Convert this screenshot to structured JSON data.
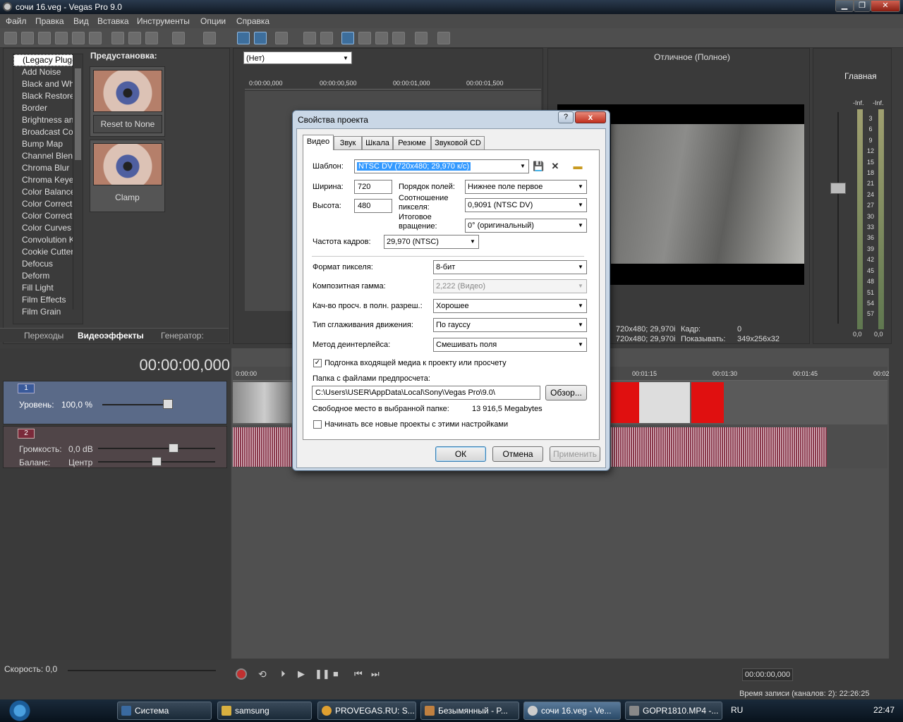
{
  "window": {
    "title": "сочи 16.veg - Vegas Pro 9.0"
  },
  "menu": [
    "Файл",
    "Правка",
    "Вид",
    "Вставка",
    "Инструменты",
    "Опции",
    "Справка"
  ],
  "effects": {
    "items": [
      "(Legacy Plug-I",
      "Add Noise",
      "Black and Whit",
      "Black Restore",
      "Border",
      "Brightness and",
      "Broadcast Colo",
      "Bump Map",
      "Channel Blend",
      "Chroma Blur",
      "Chroma Keyer",
      "Color Balance",
      "Color Correcto",
      "Color Correcto",
      "Color Curves",
      "Convolution Ke",
      "Cookie Cutter",
      "Defocus",
      "Deform",
      "Fill Light",
      "Film Effects",
      "Film Grain"
    ],
    "preset_header": "Предустановка:",
    "preset1_label": "Reset to None",
    "preset2_label": "Clamp",
    "tabs": [
      "Переходы",
      "Видеоэффекты",
      "Генератор:"
    ]
  },
  "trimmer": {
    "dropdown": "(Нет)",
    "times": [
      "0:00:00,000",
      "00:00:00,500",
      "00:00:01,000",
      "00:00:01,500"
    ]
  },
  "preview": {
    "quality": "Отличное (Полное)",
    "info1": "720x480; 29,970i",
    "info2": "720x480; 29,970i",
    "frame_label": "Кадр:",
    "frame_value": "0",
    "show_label": "Показывать:",
    "show_value": "349x256x32"
  },
  "mixer": {
    "title": "Главная",
    "inf_left": "-Inf.",
    "inf_right": "-Inf.",
    "scale": [
      "3",
      "6",
      "9",
      "12",
      "15",
      "18",
      "21",
      "24",
      "27",
      "30",
      "33",
      "36",
      "39",
      "42",
      "45",
      "48",
      "51",
      "54",
      "57"
    ],
    "bottom_left": "0,0",
    "bottom_right": "0,0"
  },
  "timeline": {
    "timecode": "00:00:00,000",
    "track1_num": "1",
    "level_label": "Уровень:",
    "level_value": "100,0 %",
    "track2_num": "2",
    "volume_label": "Громкость:",
    "volume_value": "0,0 dB",
    "pan_label": "Баланс:",
    "pan_value": "Центр",
    "ruler": [
      "0:00:00",
      "00:01:15",
      "00:01:30",
      "00:01:45",
      "00:02"
    ]
  },
  "transport": {
    "speed": "Скорость: 0,0",
    "time_display": "00:00:00,000",
    "record_time": "Время записи (каналов: 2): 22:26:25"
  },
  "dialog": {
    "title": "Свойства проекта",
    "help": "?",
    "close": "x",
    "tabs": [
      "Видео",
      "Звук",
      "Шкала",
      "Резюме",
      "Звуковой CD"
    ],
    "template_label": "Шаблон:",
    "template_value": "NTSC DV (720x480; 29,970 к/с)",
    "width_label": "Ширина:",
    "width_value": "720",
    "height_label": "Высота:",
    "height_value": "480",
    "field_order_label": "Порядок полей:",
    "field_order_value": "Нижнее поле первое",
    "pixel_aspect_label1": "Соотношение",
    "pixel_aspect_label2": "пикселя:",
    "pixel_aspect_value": "0,9091 (NTSC DV)",
    "rotation_label1": "Итоговое",
    "rotation_label2": "вращение:",
    "rotation_value": "0° (оригинальный)",
    "framerate_label": "Частота кадров:",
    "framerate_value": "29,970 (NTSC)",
    "pixel_format_label": "Формат пикселя:",
    "pixel_format_value": "8-бит",
    "gamma_label": "Композитная гамма:",
    "gamma_value": "2,222 (Видео)",
    "preview_quality_label": "Кач-во просч. в полн. разреш.:",
    "preview_quality_value": "Хорошее",
    "motion_blur_label": "Тип сглаживания движения:",
    "motion_blur_value": "По гауссу",
    "deinterlace_label": "Метод деинтерлейса:",
    "deinterlace_value": "Смешивать поля",
    "adapt_media_label": "Подгонка входящей медиа к проекту или просчету",
    "adapt_media_checked": "✓",
    "folder_label": "Папка с файлами предпросчета:",
    "folder_value": "C:\\Users\\USER\\AppData\\Local\\Sony\\Vegas Pro\\9.0\\",
    "browse": "Обзор...",
    "free_space_label": "Свободное место в выбранной папке:",
    "free_space_value": "13 916,5 Megabytes",
    "new_projects_label": "Начинать все новые проекты с этими настройками",
    "ok": "ОК",
    "cancel": "Отмена",
    "apply": "Применить"
  },
  "taskbar": {
    "items": [
      "Система",
      "samsung",
      "PROVEGAS.RU: S...",
      "Безымянный - P...",
      "сочи 16.veg - Ve...",
      "GOPR1810.MP4 -..."
    ],
    "lang": "RU",
    "clock": "22:47"
  }
}
